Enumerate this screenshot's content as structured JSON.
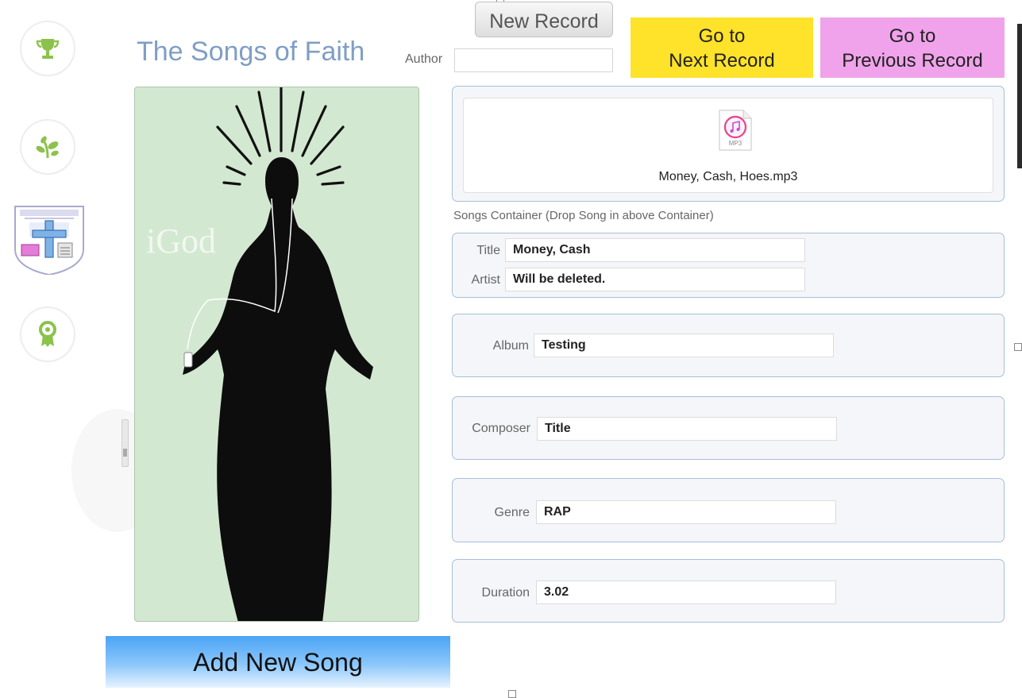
{
  "app": {
    "title": "The Songs of Faith"
  },
  "toolbar": {
    "new_record_label": "New Record",
    "author_label": "Author",
    "author_value": "",
    "next_record_label_line1": "Go to",
    "next_record_label_line2": "Next Record",
    "prev_record_label_line1": "Go to",
    "prev_record_label_line2": "Previous Record"
  },
  "sidebar": {
    "icons": [
      "trophy-icon",
      "sprout-icon",
      "school-crest-icon",
      "award-ribbon-icon"
    ]
  },
  "image_panel": {
    "overlay_text": "iGod"
  },
  "song_container": {
    "file_badge": "MP3",
    "file_name": "Money, Cash, Hoes.mp3",
    "caption": "Songs Container (Drop Song in above Container)"
  },
  "fields": {
    "title": {
      "label": "Title",
      "value": "Money, Cash"
    },
    "artist": {
      "label": "Artist",
      "value": "Will be deleted."
    },
    "album": {
      "label": "Album",
      "value": "Testing"
    },
    "composer": {
      "label": "Composer",
      "value": "Title"
    },
    "genre": {
      "label": "Genre",
      "value": "RAP"
    },
    "duration": {
      "label": "Duration",
      "value": "3.02"
    }
  },
  "actions": {
    "add_song_label": "Add New Song"
  },
  "colors": {
    "next_button": "#ffe22a",
    "prev_button": "#f0a3ea",
    "title_text": "#7f9ec4",
    "image_bg": "#d3e8d0",
    "add_button": "#4aa3f5",
    "icon_green": "#8bc34a"
  }
}
